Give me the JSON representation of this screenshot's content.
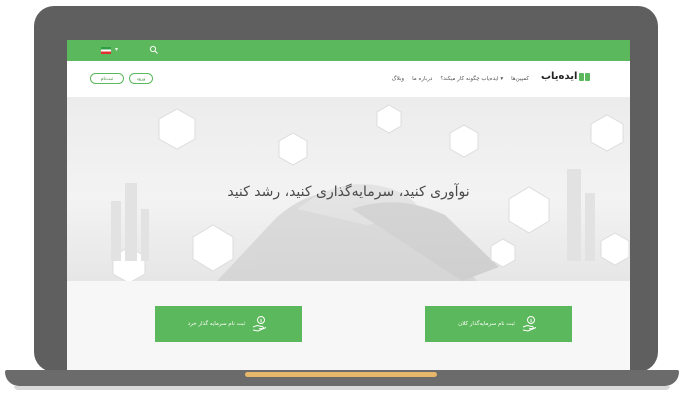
{
  "topbar": {
    "flag_icon": "iran-flag-icon",
    "language_caret": "▾",
    "search_icon": "search-icon"
  },
  "navbar": {
    "register_label": "ثبت‌نام",
    "login_label": "ورود",
    "logo_text": "ایده‌یاب",
    "menu": [
      "کمپین‌ها",
      "ایده‌یاب چگونه کار میکند؟ ▾",
      "درباره ما",
      "وبلاگ"
    ]
  },
  "hero": {
    "title": "نوآوری کنید، سرمایه‌گذاری کنید، رشد کنید"
  },
  "actions": {
    "left_label": "ثبت نام سرمایه گذار خرد",
    "right_label": "ثبت نام سرمایه‌گذار کلان",
    "left_icon": "money-hand-icon",
    "right_icon": "money-hand-icon"
  },
  "colors": {
    "brand_green": "#5cb85c",
    "laptop_frame": "#5f5f5f",
    "hinge_accent": "#e8b86a"
  }
}
